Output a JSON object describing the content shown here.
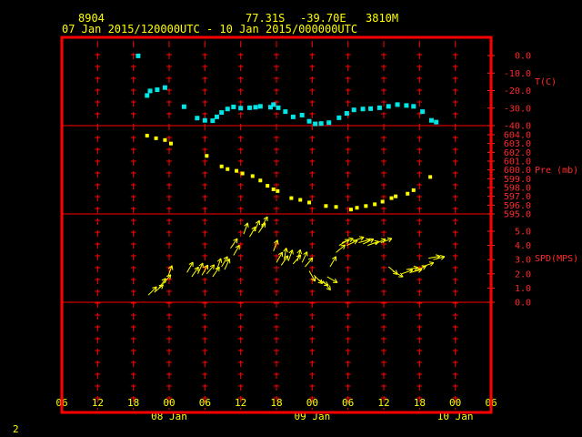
{
  "header": {
    "station_id": "8904",
    "lat": "77.31S",
    "lon": "-39.70E",
    "elev": "3810M",
    "period": "07 Jan 2015/120000UTC - 10 Jan 2015/000000UTC"
  },
  "footer": {
    "page": "2"
  },
  "colors": {
    "frame": "#ff0000",
    "temp": "#00e5e5",
    "pres": "#ffff00",
    "wind": "#ffff00",
    "text": "#ffff00",
    "axis": "#ff2a2a"
  },
  "chart_data": [
    {
      "type": "scatter",
      "name": "T(C)",
      "ylabel": "T(C)",
      "ylim": [
        -40,
        0
      ],
      "ytick_labels": [
        "0.0",
        "-10.0",
        "-20.0",
        "-30.0",
        "-40.0"
      ],
      "x_unit": "hours since 07 Jan 2015 06 UTC",
      "x": [
        12.8,
        14.3,
        14.8,
        16.0,
        17.3,
        20.5,
        22.7,
        24.0,
        25.3,
        26.0,
        26.8,
        27.8,
        28.8,
        30.0,
        31.5,
        32.5,
        33.3,
        35.0,
        35.5,
        36.3,
        37.5,
        38.8,
        40.3,
        41.5,
        42.5,
        43.5,
        44.8,
        46.5,
        47.8,
        49.0,
        50.5,
        51.8,
        53.3,
        54.8,
        56.3,
        57.8,
        59.0,
        60.5,
        62.0,
        62.8
      ],
      "y": [
        -0.2,
        -22.8,
        -20.2,
        -19.5,
        -18.3,
        -29.2,
        -35.7,
        -37.0,
        -37.2,
        -35.0,
        -32.5,
        -30.5,
        -29.3,
        -30.0,
        -29.8,
        -29.5,
        -29.0,
        -29.5,
        -28.0,
        -29.8,
        -32.0,
        -35.0,
        -34.0,
        -37.5,
        -39.0,
        -38.8,
        -38.3,
        -35.5,
        -33.0,
        -31.0,
        -30.5,
        -30.3,
        -29.8,
        -29.0,
        -28.0,
        -28.5,
        -29.0,
        -32.0,
        -37.0,
        -38.0
      ]
    },
    {
      "type": "scatter",
      "name": "Pre (mb)",
      "ylabel": "Pre (mb)",
      "ylim": [
        595,
        604
      ],
      "ytick_labels": [
        "604.0",
        "603.0",
        "602.0",
        "601.0",
        "600.0",
        "599.0",
        "598.0",
        "597.0",
        "596.0",
        "595.0"
      ],
      "x_unit": "hours since 07 Jan 2015 06 UTC",
      "x": [
        14.3,
        15.8,
        17.3,
        18.3,
        24.3,
        26.8,
        27.8,
        29.3,
        30.3,
        32.0,
        33.3,
        34.5,
        35.5,
        36.2,
        38.5,
        40.0,
        41.5,
        44.3,
        46.0,
        48.5,
        49.5,
        51.0,
        52.5,
        53.8,
        55.3,
        56.0,
        58.0,
        59.0,
        61.8
      ],
      "y": [
        603.9,
        603.6,
        603.4,
        603.0,
        601.6,
        600.4,
        600.1,
        599.9,
        599.6,
        599.3,
        598.8,
        598.2,
        597.8,
        597.6,
        596.8,
        596.6,
        596.3,
        595.9,
        595.8,
        595.5,
        595.7,
        595.9,
        596.1,
        596.4,
        596.8,
        597.0,
        597.3,
        597.7,
        599.2
      ]
    },
    {
      "type": "scatter",
      "name": "SPD(MPS)",
      "ylabel": "SPD(MPS)",
      "ylim": [
        0,
        5
      ],
      "ytick_labels": [
        "5.0",
        "4.0",
        "3.0",
        "2.0",
        "1.0",
        "0.0"
      ],
      "x_unit": "hours since 07 Jan 2015 06 UTC",
      "x": [
        14.5,
        15.5,
        16.3,
        17.0,
        17.8,
        21.0,
        21.8,
        22.8,
        23.5,
        24.3,
        25.3,
        26.0,
        26.8,
        27.3,
        28.3,
        28.8,
        30.5,
        31.5,
        32.3,
        33.0,
        33.5,
        35.5,
        36.0,
        36.8,
        37.3,
        38.0,
        38.8,
        39.5,
        40.3,
        40.8,
        41.5,
        42.3,
        43.0,
        43.8,
        44.5,
        45.0,
        46.0,
        46.5,
        47.0,
        47.8,
        48.8,
        49.8,
        50.5,
        51.3,
        52.5,
        53.5,
        54.8,
        55.5,
        57.0,
        57.8,
        58.5,
        59.3,
        60.5,
        61.5,
        62.3
      ],
      "y": [
        0.5,
        0.7,
        1.0,
        1.3,
        1.8,
        2.1,
        1.8,
        2.0,
        1.9,
        2.0,
        1.8,
        2.3,
        2.5,
        2.3,
        3.8,
        3.3,
        4.8,
        4.6,
        5.0,
        4.9,
        5.3,
        3.6,
        2.8,
        2.6,
        3.0,
        2.9,
        2.7,
        2.9,
        2.8,
        2.5,
        2.2,
        1.9,
        1.6,
        1.5,
        1.8,
        2.5,
        3.5,
        4.0,
        4.2,
        4.0,
        4.3,
        4.2,
        4.1,
        4.0,
        4.1,
        4.2,
        2.5,
        2.2,
        2.0,
        2.3,
        2.1,
        2.2,
        2.5,
        3.1,
        3.0
      ],
      "dir": [
        225,
        230,
        215,
        220,
        200,
        210,
        215,
        205,
        210,
        220,
        215,
        200,
        210,
        205,
        215,
        210,
        200,
        210,
        205,
        215,
        210,
        200,
        210,
        215,
        190,
        200,
        220,
        195,
        205,
        220,
        330,
        315,
        300,
        320,
        300,
        210,
        230,
        240,
        250,
        245,
        250,
        255,
        245,
        250,
        245,
        250,
        310,
        300,
        250,
        260,
        255,
        245,
        250,
        260,
        255
      ]
    }
  ],
  "x_axis": {
    "ticks": [
      {
        "h": 0,
        "label": "06"
      },
      {
        "h": 6,
        "label": "12"
      },
      {
        "h": 12,
        "label": "18"
      },
      {
        "h": 18,
        "label": "00"
      },
      {
        "h": 24,
        "label": "06"
      },
      {
        "h": 30,
        "label": "12"
      },
      {
        "h": 36,
        "label": "18"
      },
      {
        "h": 42,
        "label": "00"
      },
      {
        "h": 48,
        "label": "06"
      },
      {
        "h": 54,
        "label": "12"
      },
      {
        "h": 60,
        "label": "18"
      },
      {
        "h": 66,
        "label": "00"
      },
      {
        "h": 72,
        "label": "06"
      }
    ],
    "day_labels": [
      {
        "h": 18,
        "label": "08 Jan"
      },
      {
        "h": 42,
        "label": "09 Jan"
      },
      {
        "h": 66,
        "label": "10 Jan"
      }
    ]
  }
}
